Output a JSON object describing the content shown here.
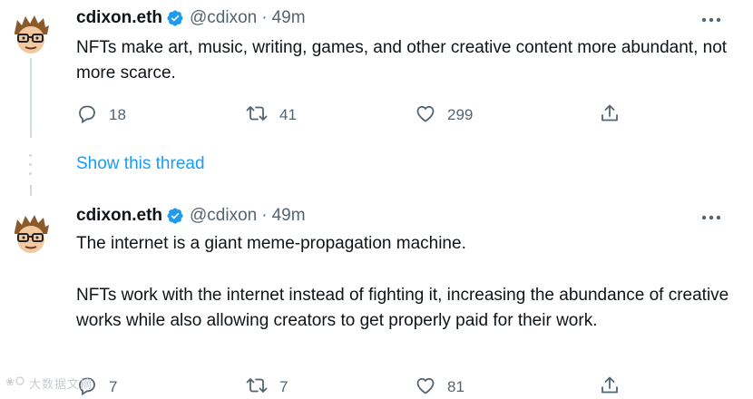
{
  "tweets": [
    {
      "name": "cdixon.eth",
      "handle": "@cdixon",
      "separator": "·",
      "time": "49m",
      "text_paragraphs": [
        "NFTs make art, music, writing, games, and other creative content more abundant, not more scarce."
      ],
      "replies": "18",
      "retweets": "41",
      "likes": "299"
    },
    {
      "name": "cdixon.eth",
      "handle": "@cdixon",
      "separator": "·",
      "time": "49m",
      "text_paragraphs": [
        "The internet is a giant meme-propagation machine.",
        "NFTs work with the internet instead of fighting it, increasing the abundance of creative works while also allowing creators to get properly paid for their work."
      ],
      "replies": "7",
      "retweets": "7",
      "likes": "81"
    }
  ],
  "show_thread_label": "Show this thread",
  "watermark": {
    "text": "大数据文摘"
  },
  "colors": {
    "accent": "#1d9bf0",
    "text": "#0f1419",
    "secondary": "#536471",
    "line": "#cfd9de"
  },
  "icons": {
    "verified": "verified-badge-icon",
    "more": "more-dots-icon",
    "reply": "reply-icon",
    "retweet": "retweet-icon",
    "like": "heart-icon",
    "share": "share-icon"
  }
}
